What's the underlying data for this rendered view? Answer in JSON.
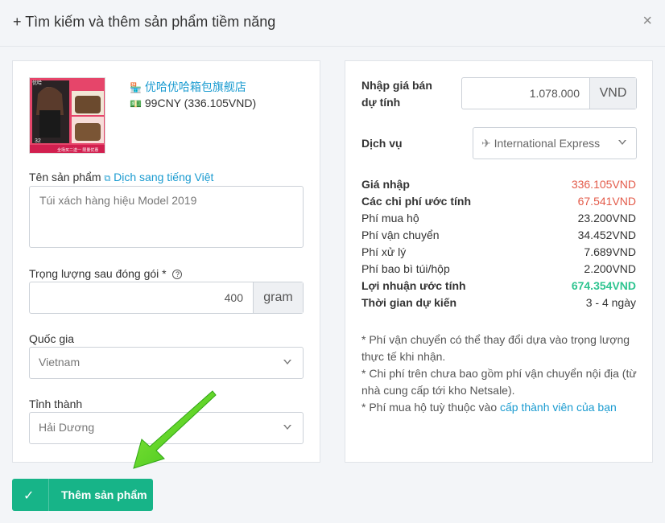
{
  "dialog": {
    "title": "+ Tìm kiếm và thêm sản phẩm tiềm năng",
    "close": "×"
  },
  "product": {
    "shop": "优哈优哈箱包旗舰店",
    "price": "99CNY (336.105VND)",
    "thumb_text": {
      "badge": "优哈",
      "price_tag": "32",
      "bottom_banner": "全场买二送一 限量优惠"
    }
  },
  "form": {
    "name_label": "Tên sản phẩm",
    "translate_link": "Dịch sang tiếng Việt",
    "name_value": "Túi xách hàng hiệu Model 2019",
    "weight_label": "Trọng lượng sau đóng gói *",
    "weight_value": "400",
    "weight_unit": "gram",
    "country_label": "Quốc gia",
    "country_value": "Vietnam",
    "province_label": "Tỉnh thành",
    "province_value": "Hải Dương"
  },
  "pricing": {
    "sell_price_label": "Nhập giá bán dự tính",
    "sell_price_value": "1.078.000",
    "sell_price_unit": "VND",
    "service_label": "Dịch vụ",
    "service_value": "International Express",
    "rows": [
      {
        "label": "Giá nhập",
        "value": "336.105VND"
      },
      {
        "label": "Các chi phí ước tính",
        "value": "67.541VND"
      },
      {
        "label": "Phí mua hộ",
        "value": "23.200VND"
      },
      {
        "label": "Phí vận chuyển",
        "value": "34.452VND"
      },
      {
        "label": "Phí xử lý",
        "value": "7.689VND"
      },
      {
        "label": "Phí bao bì túi/hộp",
        "value": "2.200VND"
      },
      {
        "label": "Lợi nhuận ước tính",
        "value": "674.354VND"
      },
      {
        "label": "Thời gian dự kiến",
        "value": "3 - 4 ngày"
      }
    ],
    "notes": [
      "* Phí vận chuyển có thể thay đổi dựa vào trọng lượng thực tế khi nhận.",
      "* Chi phí trên chưa bao gồm phí vận chuyển nội địa (từ nhà cung cấp tới kho Netsale)."
    ],
    "note3_prefix": "* Phí mua hộ tuỳ thuộc vào",
    "note3_link": "cấp thành viên của bạn"
  },
  "actions": {
    "add_label": "Thêm sản phẩm"
  },
  "colors": {
    "accent": "#17b488",
    "link": "#1a9bd0",
    "red": "#e35b4a",
    "green": "#2ec490"
  }
}
